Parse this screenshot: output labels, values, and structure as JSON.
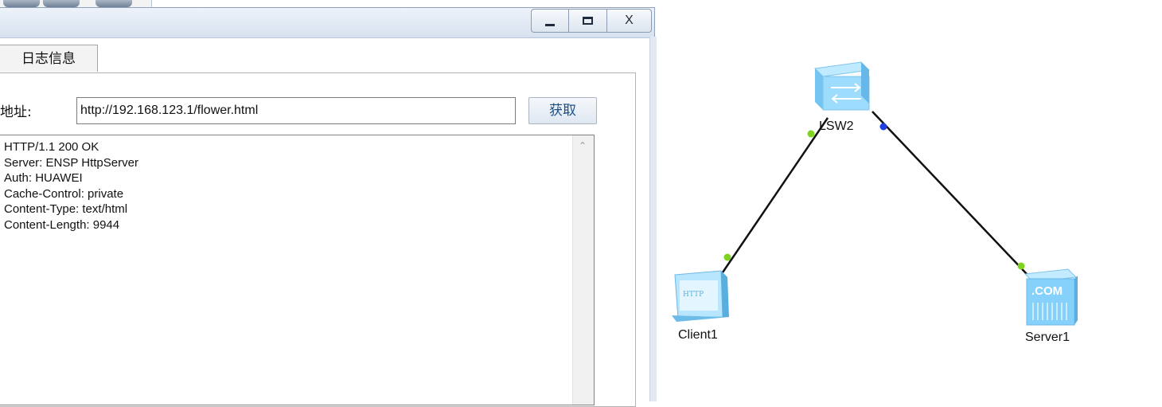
{
  "window": {
    "controls": {
      "minimize": "_",
      "maximize": "☐",
      "close": "X"
    },
    "tab_label": "日志信息",
    "url_label": "地址:",
    "url_value": "http://192.168.123.1/flower.html",
    "fetch_button": "获取",
    "response_lines": [
      "HTTP/1.1 200 OK",
      "Server: ENSP HttpServer",
      "Auth: HUAWEI",
      "Cache-Control: private",
      "Content-Type: text/html",
      "Content-Length: 9944"
    ]
  },
  "topology": {
    "nodes": {
      "switch": {
        "label": "LSW2",
        "icon": "switch-icon"
      },
      "client": {
        "label": "Client1",
        "icon": "http-client-icon",
        "badge": "HTTP"
      },
      "server": {
        "label": "Server1",
        "icon": "server-icon",
        "badge": ".COM"
      }
    },
    "port_colors": {
      "up": "#7ed321",
      "blue": "#1f3fe0"
    },
    "link_color": "#111111"
  }
}
